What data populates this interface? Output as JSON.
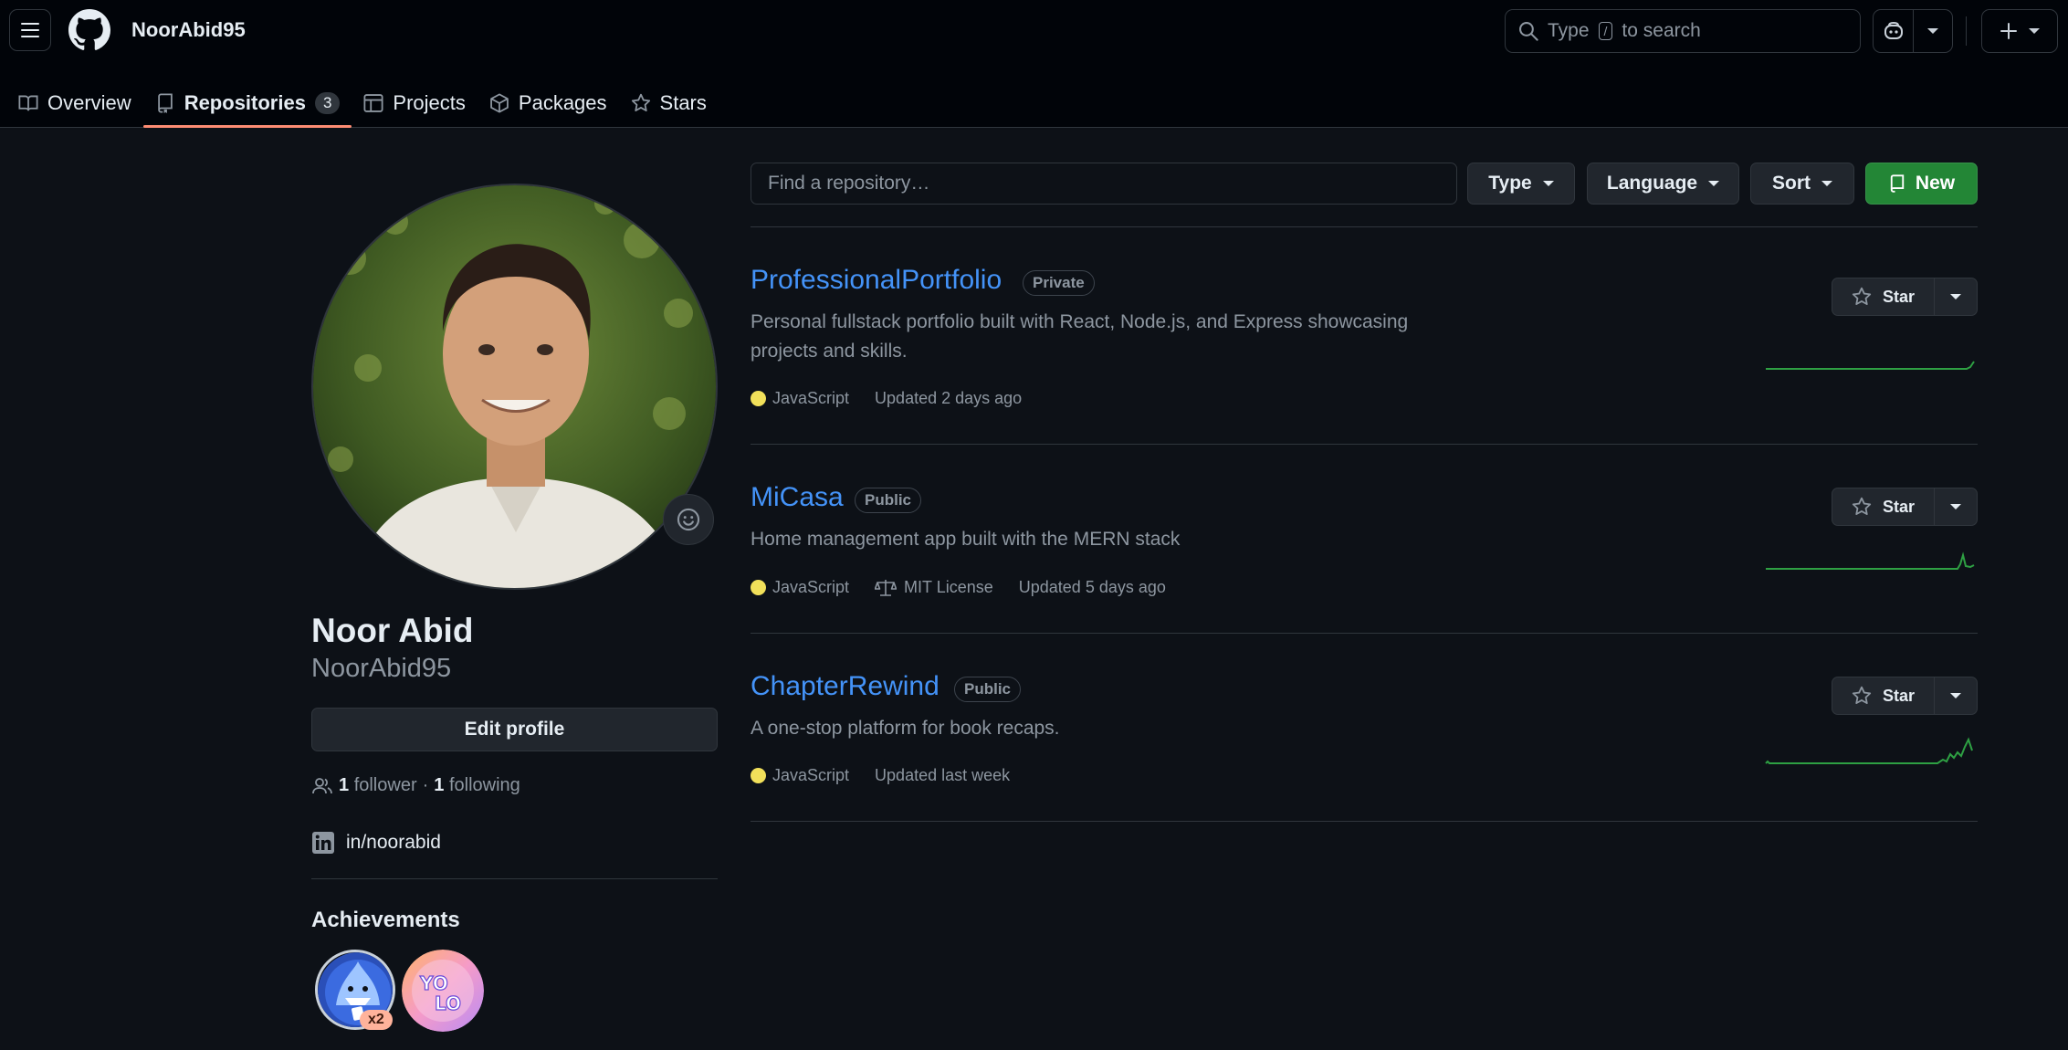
{
  "header": {
    "username": "NoorAbid95",
    "search_placeholder_pre": "Type",
    "search_key": "/",
    "search_placeholder_post": "to search"
  },
  "tabs": [
    {
      "label": "Overview",
      "icon": "book-icon"
    },
    {
      "label": "Repositories",
      "icon": "repo-icon",
      "count": "3",
      "active": true
    },
    {
      "label": "Projects",
      "icon": "table-icon"
    },
    {
      "label": "Packages",
      "icon": "package-icon"
    },
    {
      "label": "Stars",
      "icon": "star-icon"
    }
  ],
  "profile": {
    "full_name": "Noor Abid",
    "login": "NoorAbid95",
    "edit_label": "Edit profile",
    "followers": "1",
    "followers_label": "follower",
    "following": "1",
    "following_label": "following",
    "linkedin": "in/noorabid",
    "achievements_title": "Achievements",
    "achievement_multiplier": "x2"
  },
  "filters": {
    "find_placeholder": "Find a repository…",
    "type_label": "Type",
    "language_label": "Language",
    "sort_label": "Sort",
    "new_label": "New"
  },
  "repos": [
    {
      "name": "ProfessionalPortfolio",
      "visibility": "Private",
      "description": "Personal fullstack portfolio built with React, Node.js, and Express showcasing projects and skills.",
      "language": "JavaScript",
      "license": "",
      "updated": "Updated 2 days ago",
      "star_label": "Star"
    },
    {
      "name": "MiCasa",
      "visibility": "Public",
      "description": "Home management app built with the MERN stack",
      "language": "JavaScript",
      "license": "MIT License",
      "updated": "Updated 5 days ago",
      "star_label": "Star"
    },
    {
      "name": "ChapterRewind",
      "visibility": "Public",
      "description": "A one-stop platform for book recaps.",
      "language": "JavaScript",
      "license": "",
      "updated": "Updated last week",
      "star_label": "Star"
    }
  ],
  "colors": {
    "accent_link": "#4493f8",
    "new_button": "#238636",
    "javascript": "#f1e05a",
    "tab_underline": "#fd8c73",
    "sparkline": "#2ea043"
  }
}
